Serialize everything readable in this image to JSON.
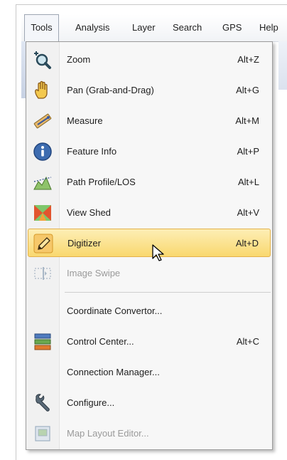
{
  "menubar": {
    "items": [
      {
        "label": "Tools",
        "active": true
      },
      {
        "label": "Analysis"
      },
      {
        "label": "Layer"
      },
      {
        "label": "Search"
      },
      {
        "label": "GPS"
      },
      {
        "label": "Help"
      }
    ]
  },
  "tools_menu": {
    "items": [
      {
        "label": "Zoom",
        "shortcut": "Alt+Z",
        "icon": "zoom-magnifier-icon"
      },
      {
        "label": "Pan (Grab-and-Drag)",
        "shortcut": "Alt+G",
        "icon": "hand-icon"
      },
      {
        "label": "Measure",
        "shortcut": "Alt+M",
        "icon": "ruler-icon"
      },
      {
        "label": "Feature Info",
        "shortcut": "Alt+P",
        "icon": "info-icon"
      },
      {
        "label": "Path Profile/LOS",
        "shortcut": "Alt+L",
        "icon": "terrain-profile-icon"
      },
      {
        "label": "View Shed",
        "shortcut": "Alt+V",
        "icon": "viewshed-icon"
      },
      {
        "label": "Digitizer",
        "shortcut": "Alt+D",
        "icon": "pencil-icon",
        "highlighted": true
      },
      {
        "label": "Image Swipe",
        "shortcut": "",
        "icon": "image-swipe-icon",
        "disabled": true
      },
      {
        "label": "Coordinate Convertor...",
        "shortcut": ""
      },
      {
        "label": "Control Center...",
        "shortcut": "Alt+C",
        "icon": "control-center-icon"
      },
      {
        "label": "Connection Manager...",
        "shortcut": ""
      },
      {
        "label": "Configure...",
        "shortcut": "",
        "icon": "wrench-icon"
      },
      {
        "label": "Map Layout Editor...",
        "shortcut": "",
        "icon": "map-layout-icon",
        "disabled": true
      }
    ]
  },
  "colors": {
    "highlight_top": "#fdeeb5",
    "highlight_bottom": "#f9d86f",
    "highlight_border": "#e4b14b",
    "disabled_text": "#9a9a9a"
  }
}
